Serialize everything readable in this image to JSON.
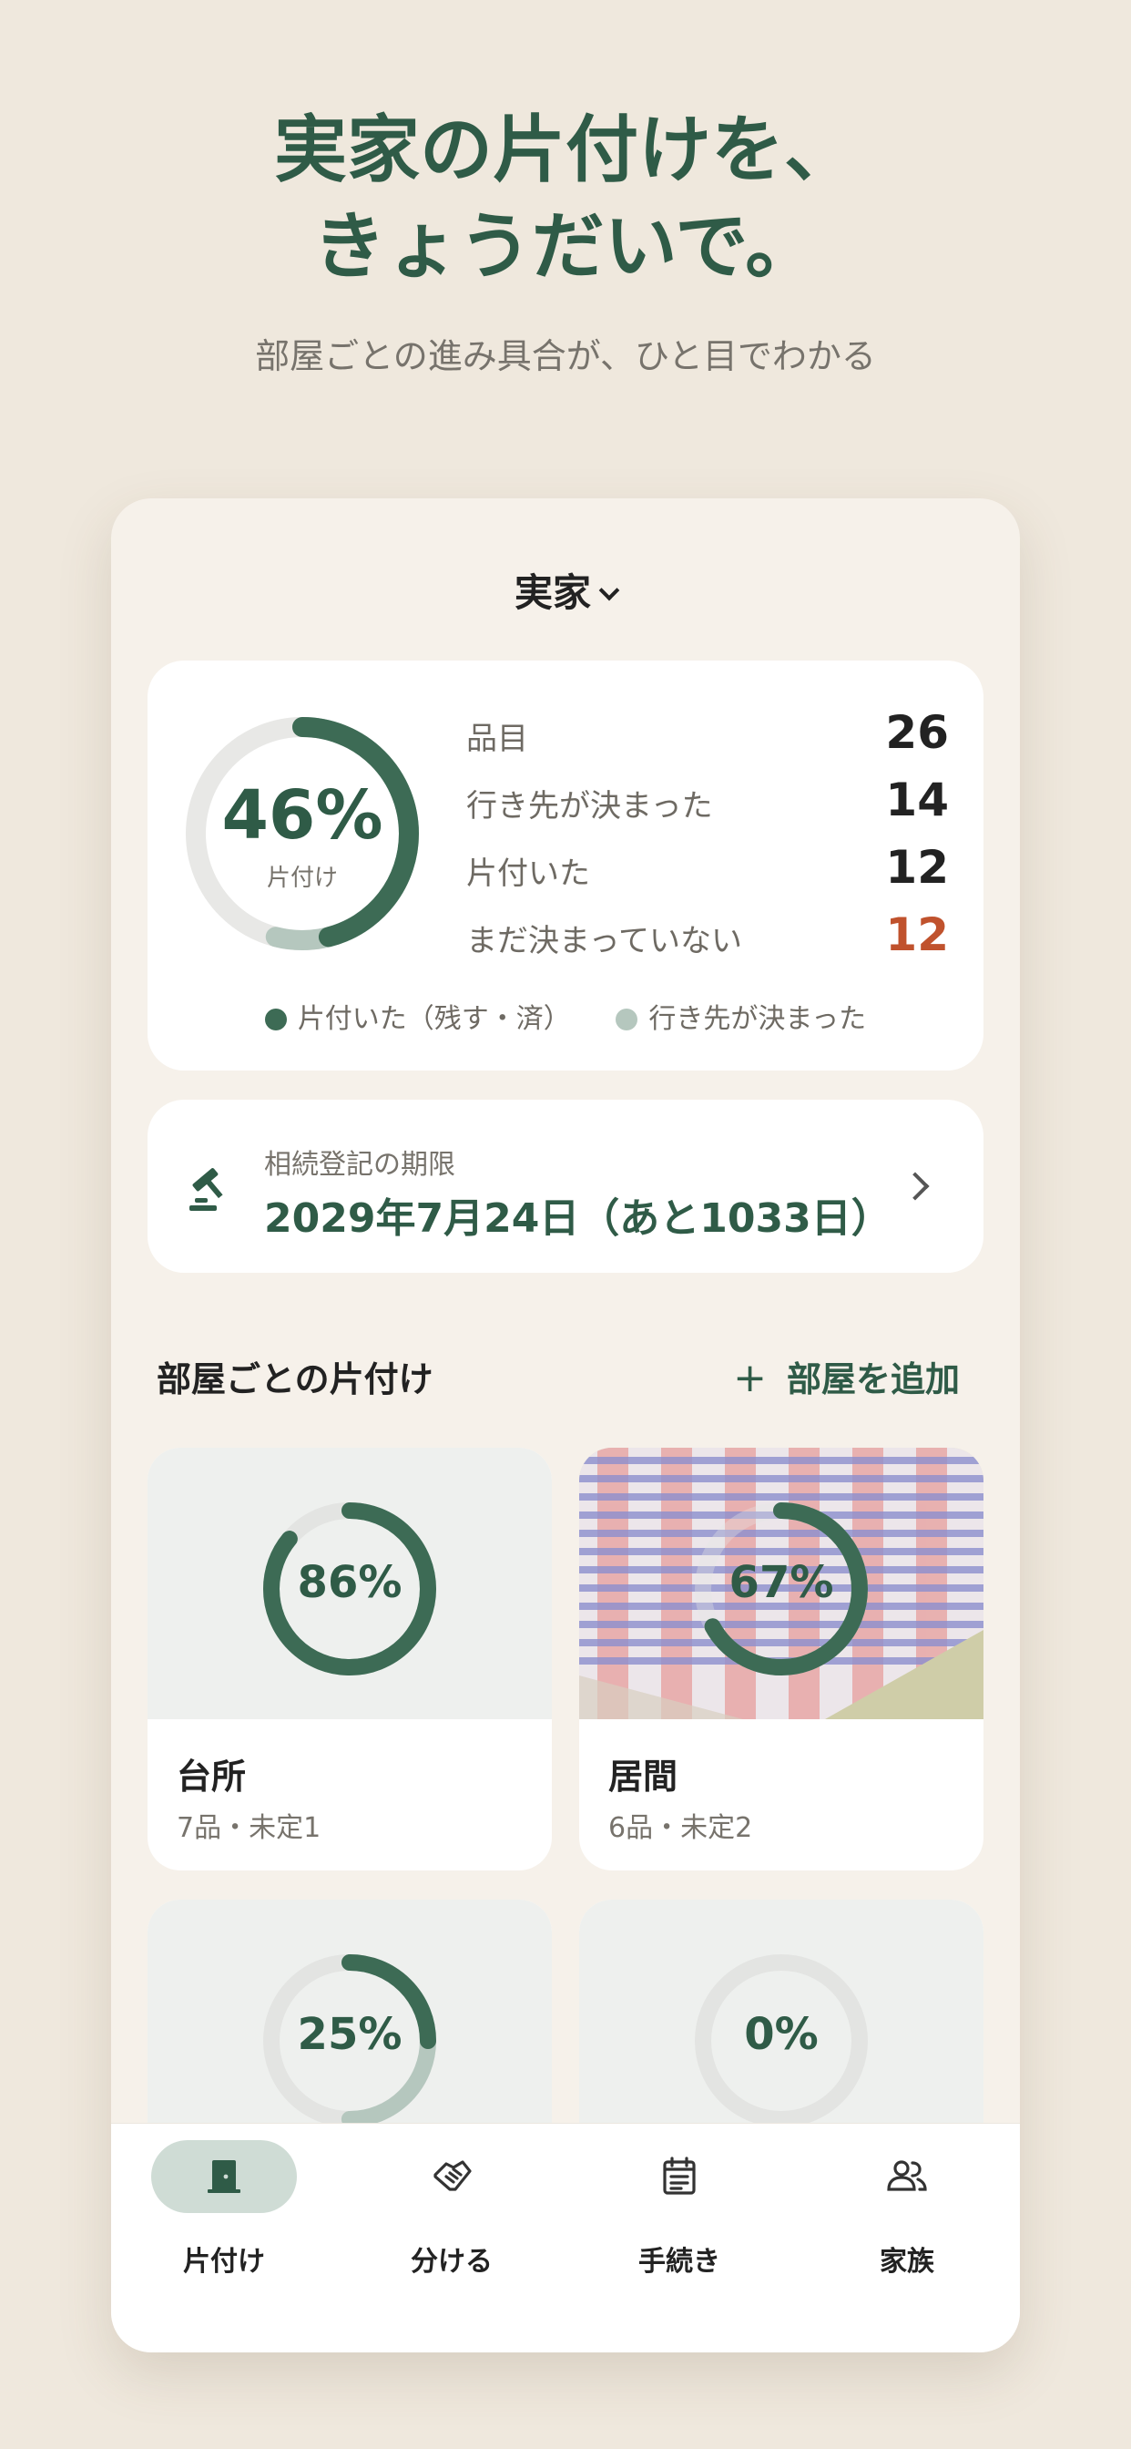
{
  "hero": {
    "headline_line1": "実家の片付けを、",
    "headline_line2": "きょうだいで。",
    "subline": "部屋ごとの進み具合が、ひと目でわかる"
  },
  "home_selector": {
    "label": "実家"
  },
  "summary": {
    "percent_label": "46%",
    "percent_caption": "片付け",
    "progress": {
      "done_fraction": 0.46,
      "destination_decided_fraction": 0.08
    },
    "stats": [
      {
        "label": "品目",
        "value": "26"
      },
      {
        "label": "行き先が決まった",
        "value": "14"
      },
      {
        "label": "片付いた",
        "value": "12"
      },
      {
        "label": "まだ決まっていない",
        "value": "12"
      }
    ],
    "legend": [
      {
        "label": "片付いた（残す・済）",
        "color": "#3D6B55"
      },
      {
        "label": "行き先が決まった",
        "color": "#B5C7BE"
      }
    ]
  },
  "deadline": {
    "label": "相続登記の期限",
    "value": "2029年7月24日（あと1033日）",
    "icon": "gavel-icon"
  },
  "rooms_section": {
    "title": "部屋ごとの片付け",
    "add_label": "部屋を追加"
  },
  "rooms": [
    {
      "percent_label": "86%",
      "done_fraction": 0.86,
      "decided_fraction": 0.0,
      "name": "台所",
      "meta": "7品・未定1"
    },
    {
      "percent_label": "67%",
      "done_fraction": 0.67,
      "decided_fraction": 0.0,
      "name": "居間",
      "meta": "6品・未定2"
    },
    {
      "percent_label": "25%",
      "done_fraction": 0.25,
      "decided_fraction": 0.25,
      "name": "",
      "meta": ""
    },
    {
      "percent_label": "0%",
      "done_fraction": 0.0,
      "decided_fraction": 0.0,
      "name": "",
      "meta": ""
    }
  ],
  "tabs": [
    {
      "label": "片付け",
      "icon": "door-icon",
      "active": true
    },
    {
      "label": "分ける",
      "icon": "handshake-icon",
      "active": false
    },
    {
      "label": "手続き",
      "icon": "calendar-icon",
      "active": false
    },
    {
      "label": "家族",
      "icon": "people-icon",
      "active": false
    }
  ],
  "colors": {
    "accent": "#2F5B47",
    "ring_done": "#3D6B55",
    "ring_decided": "#B5C7BE",
    "ring_track": "#E6E6E4",
    "warning": "#C0522D",
    "background": "#EFE8DD"
  }
}
